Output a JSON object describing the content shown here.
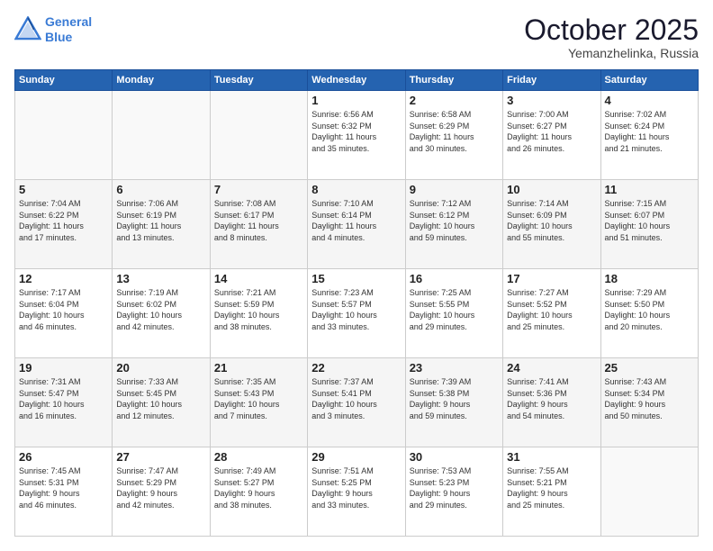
{
  "header": {
    "logo_line1": "General",
    "logo_line2": "Blue",
    "month": "October 2025",
    "location": "Yemanzhelinka, Russia"
  },
  "weekdays": [
    "Sunday",
    "Monday",
    "Tuesday",
    "Wednesday",
    "Thursday",
    "Friday",
    "Saturday"
  ],
  "weeks": [
    [
      {
        "num": "",
        "info": ""
      },
      {
        "num": "",
        "info": ""
      },
      {
        "num": "",
        "info": ""
      },
      {
        "num": "1",
        "info": "Sunrise: 6:56 AM\nSunset: 6:32 PM\nDaylight: 11 hours\nand 35 minutes."
      },
      {
        "num": "2",
        "info": "Sunrise: 6:58 AM\nSunset: 6:29 PM\nDaylight: 11 hours\nand 30 minutes."
      },
      {
        "num": "3",
        "info": "Sunrise: 7:00 AM\nSunset: 6:27 PM\nDaylight: 11 hours\nand 26 minutes."
      },
      {
        "num": "4",
        "info": "Sunrise: 7:02 AM\nSunset: 6:24 PM\nDaylight: 11 hours\nand 21 minutes."
      }
    ],
    [
      {
        "num": "5",
        "info": "Sunrise: 7:04 AM\nSunset: 6:22 PM\nDaylight: 11 hours\nand 17 minutes."
      },
      {
        "num": "6",
        "info": "Sunrise: 7:06 AM\nSunset: 6:19 PM\nDaylight: 11 hours\nand 13 minutes."
      },
      {
        "num": "7",
        "info": "Sunrise: 7:08 AM\nSunset: 6:17 PM\nDaylight: 11 hours\nand 8 minutes."
      },
      {
        "num": "8",
        "info": "Sunrise: 7:10 AM\nSunset: 6:14 PM\nDaylight: 11 hours\nand 4 minutes."
      },
      {
        "num": "9",
        "info": "Sunrise: 7:12 AM\nSunset: 6:12 PM\nDaylight: 10 hours\nand 59 minutes."
      },
      {
        "num": "10",
        "info": "Sunrise: 7:14 AM\nSunset: 6:09 PM\nDaylight: 10 hours\nand 55 minutes."
      },
      {
        "num": "11",
        "info": "Sunrise: 7:15 AM\nSunset: 6:07 PM\nDaylight: 10 hours\nand 51 minutes."
      }
    ],
    [
      {
        "num": "12",
        "info": "Sunrise: 7:17 AM\nSunset: 6:04 PM\nDaylight: 10 hours\nand 46 minutes."
      },
      {
        "num": "13",
        "info": "Sunrise: 7:19 AM\nSunset: 6:02 PM\nDaylight: 10 hours\nand 42 minutes."
      },
      {
        "num": "14",
        "info": "Sunrise: 7:21 AM\nSunset: 5:59 PM\nDaylight: 10 hours\nand 38 minutes."
      },
      {
        "num": "15",
        "info": "Sunrise: 7:23 AM\nSunset: 5:57 PM\nDaylight: 10 hours\nand 33 minutes."
      },
      {
        "num": "16",
        "info": "Sunrise: 7:25 AM\nSunset: 5:55 PM\nDaylight: 10 hours\nand 29 minutes."
      },
      {
        "num": "17",
        "info": "Sunrise: 7:27 AM\nSunset: 5:52 PM\nDaylight: 10 hours\nand 25 minutes."
      },
      {
        "num": "18",
        "info": "Sunrise: 7:29 AM\nSunset: 5:50 PM\nDaylight: 10 hours\nand 20 minutes."
      }
    ],
    [
      {
        "num": "19",
        "info": "Sunrise: 7:31 AM\nSunset: 5:47 PM\nDaylight: 10 hours\nand 16 minutes."
      },
      {
        "num": "20",
        "info": "Sunrise: 7:33 AM\nSunset: 5:45 PM\nDaylight: 10 hours\nand 12 minutes."
      },
      {
        "num": "21",
        "info": "Sunrise: 7:35 AM\nSunset: 5:43 PM\nDaylight: 10 hours\nand 7 minutes."
      },
      {
        "num": "22",
        "info": "Sunrise: 7:37 AM\nSunset: 5:41 PM\nDaylight: 10 hours\nand 3 minutes."
      },
      {
        "num": "23",
        "info": "Sunrise: 7:39 AM\nSunset: 5:38 PM\nDaylight: 9 hours\nand 59 minutes."
      },
      {
        "num": "24",
        "info": "Sunrise: 7:41 AM\nSunset: 5:36 PM\nDaylight: 9 hours\nand 54 minutes."
      },
      {
        "num": "25",
        "info": "Sunrise: 7:43 AM\nSunset: 5:34 PM\nDaylight: 9 hours\nand 50 minutes."
      }
    ],
    [
      {
        "num": "26",
        "info": "Sunrise: 7:45 AM\nSunset: 5:31 PM\nDaylight: 9 hours\nand 46 minutes."
      },
      {
        "num": "27",
        "info": "Sunrise: 7:47 AM\nSunset: 5:29 PM\nDaylight: 9 hours\nand 42 minutes."
      },
      {
        "num": "28",
        "info": "Sunrise: 7:49 AM\nSunset: 5:27 PM\nDaylight: 9 hours\nand 38 minutes."
      },
      {
        "num": "29",
        "info": "Sunrise: 7:51 AM\nSunset: 5:25 PM\nDaylight: 9 hours\nand 33 minutes."
      },
      {
        "num": "30",
        "info": "Sunrise: 7:53 AM\nSunset: 5:23 PM\nDaylight: 9 hours\nand 29 minutes."
      },
      {
        "num": "31",
        "info": "Sunrise: 7:55 AM\nSunset: 5:21 PM\nDaylight: 9 hours\nand 25 minutes."
      },
      {
        "num": "",
        "info": ""
      }
    ]
  ]
}
